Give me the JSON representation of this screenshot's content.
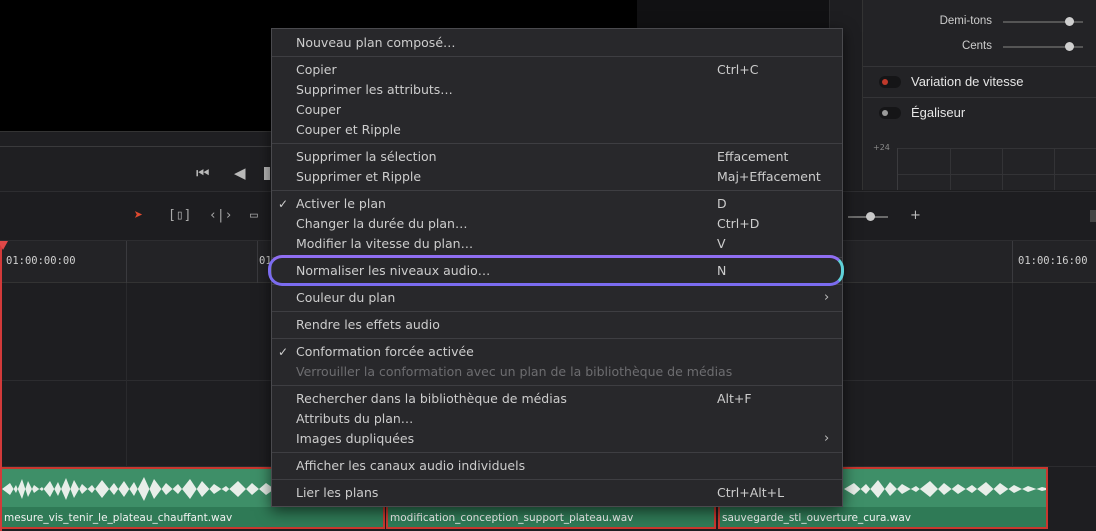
{
  "inspector": {
    "sliders": [
      {
        "label": "Demi-tons"
      },
      {
        "label": "Cents"
      }
    ],
    "sections": [
      {
        "label": "Variation de vitesse",
        "toggle_color": "#c0392b"
      },
      {
        "label": "Égaliseur",
        "toggle_color": "#9a9a9a"
      }
    ],
    "eq_axis_label": "+24"
  },
  "timeline": {
    "timecodes": [
      "01:00:00:00",
      "01",
      "01:00:16:00"
    ]
  },
  "clips": [
    {
      "name": "mesure_vis_tenir_le_plateau_chauffant.wav"
    },
    {
      "name": "modification_conception_support_plateau.wav"
    },
    {
      "name": "sauvegarde_stl_ouverture_cura.wav"
    }
  ],
  "menu": {
    "items": [
      {
        "label": "Nouveau plan composé…",
        "shortcut": ""
      },
      {
        "label": "Copier",
        "shortcut": "Ctrl+C"
      },
      {
        "label": "Supprimer les attributs…",
        "shortcut": ""
      },
      {
        "label": "Couper",
        "shortcut": ""
      },
      {
        "label": "Couper et Ripple",
        "shortcut": ""
      },
      {
        "label": "Supprimer la sélection",
        "shortcut": "Effacement"
      },
      {
        "label": "Supprimer et Ripple",
        "shortcut": "Maj+Effacement"
      },
      {
        "label": "Activer le plan",
        "shortcut": "D",
        "checked": true
      },
      {
        "label": "Changer la durée du plan…",
        "shortcut": "Ctrl+D"
      },
      {
        "label": "Modifier la vitesse du plan…",
        "shortcut": "V"
      },
      {
        "label": "Normaliser les niveaux audio…",
        "shortcut": "N"
      },
      {
        "label": "Couleur du plan",
        "shortcut": "",
        "submenu": true
      },
      {
        "label": "Rendre les effets audio",
        "shortcut": ""
      },
      {
        "label": "Conformation forcée activée",
        "shortcut": "",
        "checked": true
      },
      {
        "label": "Verrouiller la conformation avec un plan de la bibliothèque de médias",
        "shortcut": "",
        "disabled": true
      },
      {
        "label": "Rechercher dans la bibliothèque de médias",
        "shortcut": "Alt+F"
      },
      {
        "label": "Attributs du plan…",
        "shortcut": ""
      },
      {
        "label": "Images dupliquées",
        "shortcut": "",
        "submenu": true
      },
      {
        "label": "Afficher les canaux audio individuels",
        "shortcut": ""
      },
      {
        "label": "Lier les plans",
        "shortcut": "Ctrl+Alt+L"
      }
    ],
    "check_glyph": "✓",
    "submenu_glyph": "›"
  },
  "colors": {
    "highlight_ring_start": "#7b6cf0",
    "highlight_ring_end": "#5fd1d8",
    "clip_fill": "#3e8f68",
    "clip_border": "#c8372e",
    "playhead": "#d23a3a"
  }
}
